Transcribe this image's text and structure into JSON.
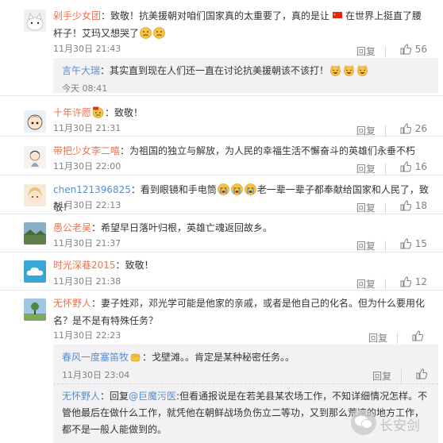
{
  "actions": {
    "reply_label": "回复"
  },
  "comments": [
    {
      "nickname": "剁手少女团",
      "body": "：致敬！抗美援朝对咱们国家真的太重要了，真的是让",
      "body2": "在世界上挺直了腰杆子！艾玛又想哭了",
      "time": "11月30日 21:43",
      "likes": "56",
      "reply": {
        "nickname": "言午大瑞",
        "body": "：其实直到现在人们还一直在讨论抗美援朝该不该打！",
        "time": "今天 08:41"
      }
    },
    {
      "nickname": "十年许愿",
      "body": "：致敬！",
      "time": "11月30日 21:31",
      "likes": "26"
    },
    {
      "nickname": "带把少女李二嘻",
      "body": "：为祖国的独立与解放，为人民的幸福生活不懈奋斗的英雄们永垂不朽",
      "time": "11月30日 22:00",
      "likes": "16"
    },
    {
      "nickname": "chen121396825",
      "body": "：看到眼镜和手电筒",
      "body2": "老一辈一辈子都奉献给国家和人民了，致敬！",
      "time": "11月30日 22:13",
      "likes": "18"
    },
    {
      "nickname": "愚公老吴",
      "body": "：希望早日落叶归根，英雄亡魂返回故乡。",
      "time": "11月30日 21:37",
      "likes": "15"
    },
    {
      "nickname": "时光深巷2015",
      "body": "：致敬！",
      "time": "11月30日 21:38",
      "likes": "12"
    },
    {
      "nickname": "无怀野人",
      "body": "：妻子姓邓，邓光学可能是他家的亲戚，或者是他自己的化名。但为什么要用化名？是不是有特殊任务？",
      "time": "11月30日 22:23",
      "likes": "",
      "replies": [
        {
          "nickname": "春风一度塞笛牧",
          "body": "：戈壁滩。。肯定是某种秘密任务。。",
          "time": "11月30日 23:04"
        },
        {
          "nickname": "无怀野人",
          "body": "：回复",
          "mention": "@巨魔污医",
          "body2": ":但看通报说是在若羌县某农场工作，不知详细情况怎样。不管他最后在做什么工作，就凭他在朝鲜战场负伤立二等功，又到那么荒凉的地方工作，都不是一般人能做到的。"
        }
      ]
    }
  ],
  "watermark": {
    "text": "长安剑"
  },
  "colors": {
    "nickname": "#eb7350",
    "reply_nickname": "#5a8ccb",
    "meta": "#808080",
    "reply_bg": "#f2f2f5"
  }
}
